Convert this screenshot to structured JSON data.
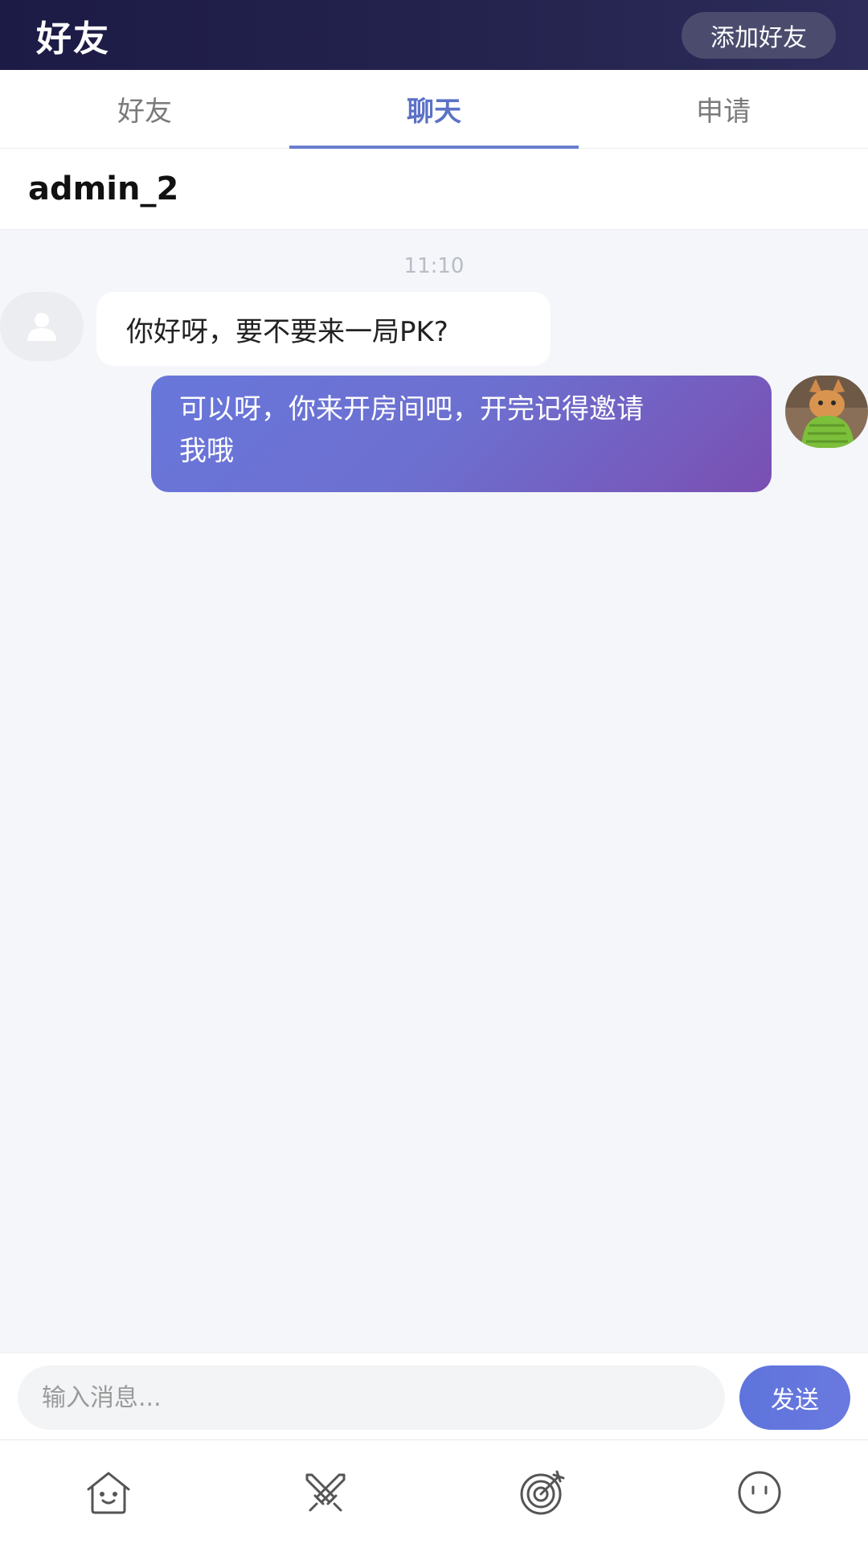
{
  "header": {
    "title": "好友",
    "add_friend_label": "添加好友"
  },
  "tabs": [
    {
      "label": "好友",
      "active": false
    },
    {
      "label": "聊天",
      "active": true
    },
    {
      "label": "申请",
      "active": false
    }
  ],
  "chat": {
    "contact_name": "admin_2",
    "timestamp": "11:10",
    "messages": [
      {
        "side": "left",
        "text": "你好呀，要不要来一局PK?"
      },
      {
        "side": "right",
        "text_line1": "可以呀，你来开房间吧，开完记得邀请",
        "text_line2": "我哦"
      }
    ]
  },
  "composer": {
    "placeholder": "输入消息...",
    "send_label": "发送"
  },
  "bottom_nav": [
    {
      "icon": "home-icon"
    },
    {
      "icon": "crossed-swords-icon"
    },
    {
      "icon": "target-icon"
    },
    {
      "icon": "face-icon"
    }
  ],
  "colors": {
    "header_bg": "#1c1b45",
    "accent": "#5b72c6",
    "bubble_gradient_start": "#6877db",
    "bubble_gradient_end": "#7a4fb2"
  }
}
